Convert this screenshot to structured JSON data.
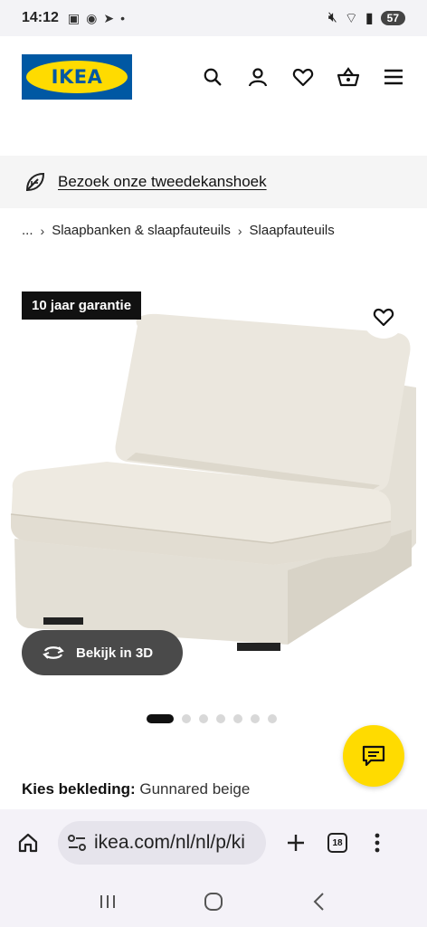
{
  "status": {
    "time": "14:12",
    "battery": "57"
  },
  "header": {
    "logo_text": "IKEA",
    "icons": [
      "search-icon",
      "account-icon",
      "heart-icon",
      "basket-icon",
      "menu-icon"
    ]
  },
  "banner": {
    "link_text": "Bezoek onze tweedekanshoek"
  },
  "breadcrumb": {
    "ellipsis": "...",
    "items": [
      "Slaapbanken & slaapfauteuils",
      "Slaapfauteuils"
    ]
  },
  "product": {
    "badge": "10 jaar garantie",
    "view3d_label": "Bekijk in 3D",
    "image_count": 7,
    "active_image": 1
  },
  "upholstery": {
    "label": "Kies bekleding:",
    "value": "Gunnared beige"
  },
  "browser": {
    "url": "ikea.com/nl/nl/p/ki",
    "tab_count": "18"
  },
  "colors": {
    "ikea_blue": "#0058a3",
    "ikea_yellow": "#ffdb00"
  }
}
